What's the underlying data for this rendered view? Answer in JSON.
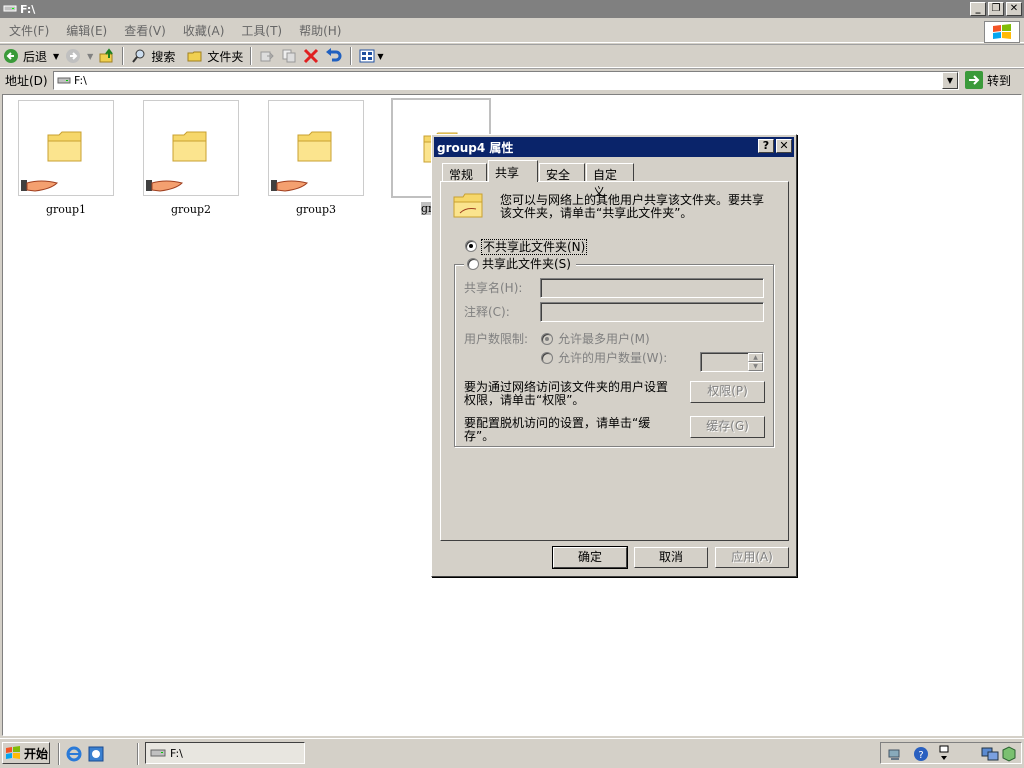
{
  "window": {
    "title": "F:\\"
  },
  "menu": {
    "items": [
      "文件(F)",
      "编辑(E)",
      "查看(V)",
      "收藏(A)",
      "工具(T)",
      "帮助(H)"
    ]
  },
  "toolbar": {
    "back_label": "后退",
    "search_label": "搜索",
    "folders_label": "文件夹"
  },
  "address": {
    "label": "地址(D)",
    "value": "F:\\",
    "go_label": "转到"
  },
  "folders": [
    {
      "name": "group1"
    },
    {
      "name": "group2"
    },
    {
      "name": "group3"
    },
    {
      "name": "group4"
    }
  ],
  "dialog": {
    "title": "group4 属性",
    "help_btn": "?",
    "close_btn": "✕",
    "tabs": [
      "常规",
      "共享",
      "安全",
      "自定义"
    ],
    "active_tab": "共享",
    "intro": "您可以与网络上的其他用户共享该文件夹。要共享该文件夹，请单击“共享此文件夹”。",
    "intro_line1": "您可以与网络上的其他用户共享该文件夹。要共享",
    "intro_line2": "该文件夹，请单击“共享此文件夹”。",
    "no_share": "不共享此文件夹(N)",
    "share": "共享此文件夹(S)",
    "share_name_label": "共享名(H):",
    "comment_label": "注释(C):",
    "user_limit_label": "用户数限制:",
    "max_allowed": "允许最多用户(M)",
    "allowed_users": "允许的用户数量(W):",
    "perm_text_line1": "要为通过网络访问该文件夹的用户设置",
    "perm_text_line2": "权限，请单击“权限”。",
    "perm_btn": "权限(P)",
    "cache_text_line1": "要配置脱机访问的设置，请单击“缓",
    "cache_text_line2": "存”。",
    "cache_btn": "缓存(G)",
    "ok": "确定",
    "cancel": "取消",
    "apply": "应用(A)"
  },
  "taskbar": {
    "start_label": "开始",
    "task_title": "F:\\"
  },
  "colors": {
    "titlebar_inactive": "#808080",
    "dialog_title": "#0a246a",
    "face": "#d4d0c8"
  }
}
